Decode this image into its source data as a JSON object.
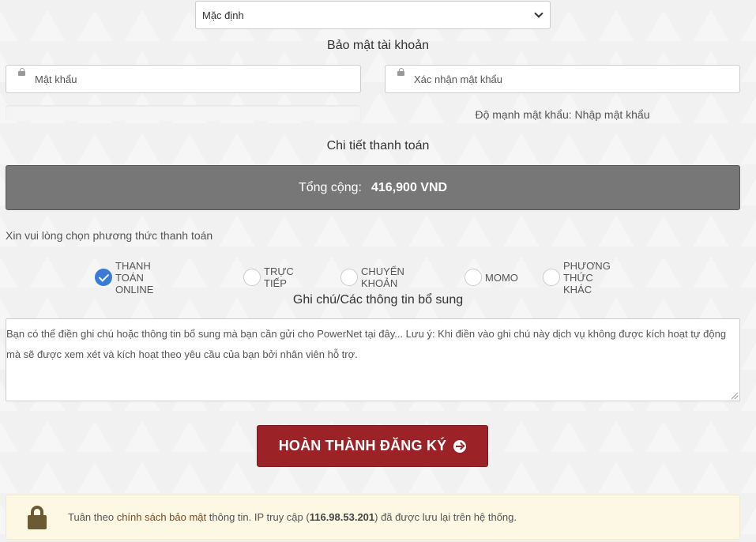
{
  "billing_cycle": {
    "selected": "Mặc định"
  },
  "account_security": {
    "title": "Bảo mật tài khoản",
    "password_placeholder": "Mật khẩu",
    "confirm_placeholder": "Xác nhận mật khẩu",
    "strength_label": "Độ mạnh mật khẩu: Nhập mật khẩu"
  },
  "payment_details": {
    "title": "Chi tiết thanh toán",
    "total_label": "Tổng cộng:",
    "total_value": "416,900 VND"
  },
  "payment_method": {
    "prompt": "Xin vui lòng chọn phương thức thanh toán",
    "options": [
      {
        "label": "THANH TOÁN ONLINE",
        "checked": true
      },
      {
        "label": "TRỰC TIẾP",
        "checked": false
      },
      {
        "label": "CHUYỂN KHOẢN",
        "checked": false
      },
      {
        "label": "MOMO",
        "checked": false
      },
      {
        "label": "PHƯƠNG THỨC KHÁC",
        "checked": false
      }
    ]
  },
  "notes": {
    "title": "Ghi chú/Các thông tin bổ sung",
    "placeholder": "Bạn có thể điền ghi chú hoặc thông tin bổ sung mà bạn cần gửi cho PowerNet tại đây... Lưu ý: Khi điền vào ghi chú này dịch vụ không được kích hoạt tự động mà sẽ được xem xét và kích hoạt theo yêu cầu của bạn bởi nhân viên hỗ trợ."
  },
  "submit": {
    "label": "HOÀN THÀNH ĐĂNG KÝ"
  },
  "privacy_notice": {
    "prefix": "Tuân theo ",
    "link": "chính sách bảo mật",
    "middle": " thông tin. IP truy cập (",
    "ip": "116.98.53.201",
    "suffix": ") đã được lưu lại trên hệ thống."
  },
  "colors": {
    "submit_bg": "#9b2226",
    "radio_checked": "#3a7bd5",
    "total_bg": "#777777",
    "notice_bg": "#fcf8e3"
  }
}
